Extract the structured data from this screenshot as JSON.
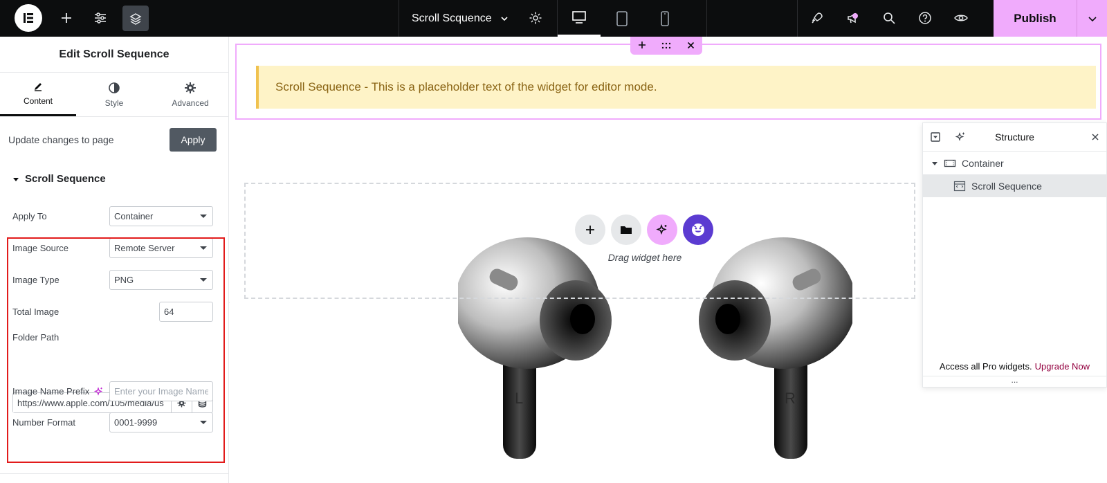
{
  "topbar": {
    "document_title": "Scroll Scquence",
    "publish_label": "Publish"
  },
  "panel": {
    "title": "Edit Scroll Sequence",
    "tabs": [
      {
        "label": "Content",
        "icon": "pencil-icon",
        "active": true
      },
      {
        "label": "Style",
        "icon": "half-circle-icon",
        "active": false
      },
      {
        "label": "Advanced",
        "icon": "gear-icon",
        "active": false
      }
    ],
    "update_text": "Update changes to page",
    "apply_label": "Apply",
    "section_title": "Scroll Sequence",
    "fields": {
      "apply_to": {
        "label": "Apply To",
        "value": "Container"
      },
      "image_source": {
        "label": "Image Source",
        "value": "Remote Server"
      },
      "image_type": {
        "label": "Image Type",
        "value": "PNG"
      },
      "total_image": {
        "label": "Total Image",
        "value": "64"
      },
      "folder_path": {
        "label": "Folder Path",
        "value": "https://www.apple.com/105/media/us"
      },
      "image_name_prefix": {
        "label": "Image Name Prefix",
        "placeholder": "Enter your Image Name"
      },
      "number_format": {
        "label": "Number Format",
        "value": "0001-9999"
      }
    }
  },
  "canvas": {
    "notice_text": "Scroll Sequence - This is a placeholder text of the widget for editor mode.",
    "drop_text": "Drag widget here",
    "earbud_left_mark": "L",
    "earbud_right_mark": "R"
  },
  "structure": {
    "title": "Structure",
    "items": [
      {
        "label": "Container"
      },
      {
        "label": "Scroll Sequence"
      }
    ],
    "footer_text": "Access all Pro widgets.",
    "footer_link": "Upgrade Now",
    "more": "..."
  },
  "colors": {
    "accent_pink": "#f0abfc",
    "highlight_red": "#e21b1b",
    "notice_bg": "#fef3c7",
    "brand_purple": "#5b3bd1"
  }
}
